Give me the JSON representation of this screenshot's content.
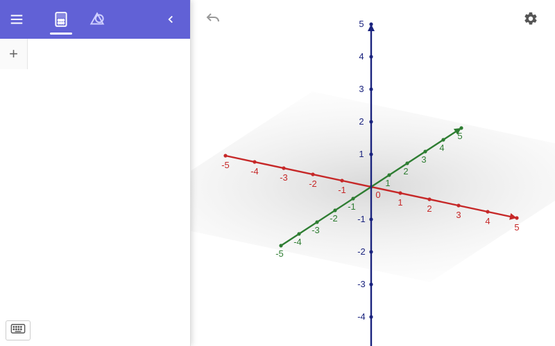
{
  "toolbar": {
    "menu_icon": "menu",
    "algebra_tab": "algebra",
    "tools_tab": "tools",
    "collapse": "collapse"
  },
  "input": {
    "add_label": "+",
    "placeholder": ""
  },
  "canvas_buttons": {
    "undo": "undo",
    "settings": "settings",
    "keyboard": "keyboard"
  },
  "chart_data": {
    "type": "scatter",
    "title": "",
    "axes": {
      "x": {
        "color": "#c62828",
        "range": [
          -5,
          5
        ],
        "ticks": [
          -5,
          -4,
          -3,
          -2,
          -1,
          0,
          1,
          2,
          3,
          4,
          5
        ]
      },
      "y": {
        "color": "#2e7d32",
        "range": [
          -5,
          5
        ],
        "ticks": [
          -5,
          -4,
          -3,
          -2,
          -1,
          1,
          2,
          3,
          4,
          5
        ]
      },
      "z": {
        "color": "#1a237e",
        "range": [
          -5,
          5
        ],
        "ticks": [
          -4,
          -3,
          -2,
          -1,
          1,
          2,
          3,
          4,
          5
        ]
      }
    },
    "series": [],
    "plane": "xy"
  }
}
